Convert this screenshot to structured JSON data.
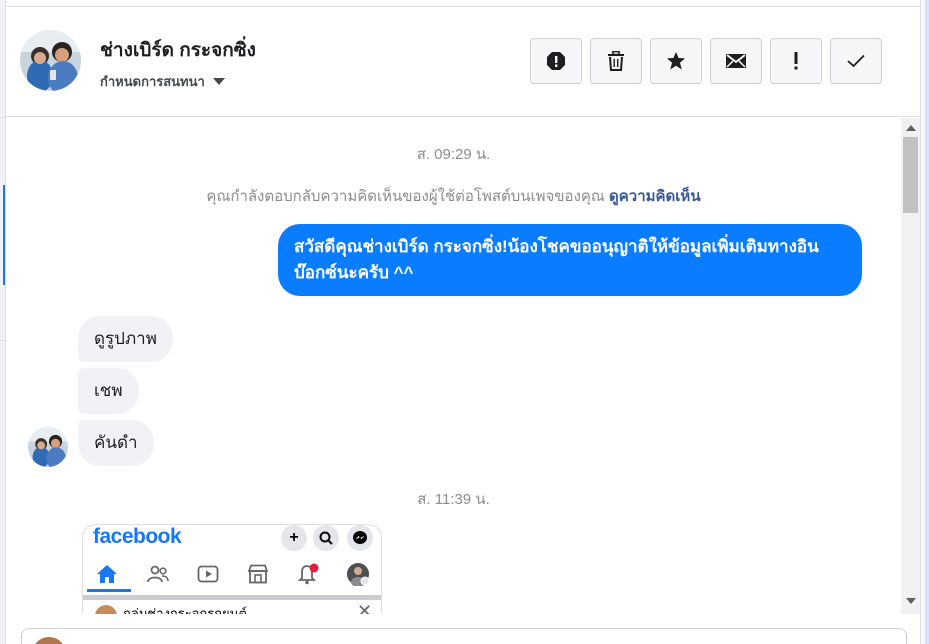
{
  "contact": {
    "name": "ช่างเบิร์ด กระจกซิ่ง",
    "assign_label": "กำหนดการสนทนา"
  },
  "actions": [
    {
      "icon": "report-icon"
    },
    {
      "icon": "trash-icon"
    },
    {
      "icon": "star-icon"
    },
    {
      "icon": "mail-icon"
    },
    {
      "icon": "exclamation-icon"
    },
    {
      "icon": "checkmark-icon"
    }
  ],
  "thread": {
    "timestamp_1": "ส. 09:29 น.",
    "notice_text": "คุณกำลังตอบกลับความคิดเห็นของผู้ใช้ต่อโพสต์บนเพจของคุณ ",
    "notice_link": "ดูความคิดเห็น",
    "outgoing_message": "สวัสดีคุณช่างเบิร์ด กระจกซิ่ง!น้องโชคขออนุญาติให้ข้อมูลเพิ่มเติมทางอินบ๊อกซ์นะครับ ^^",
    "incoming_messages": [
      "ดูรูปภาพ",
      "เชพ",
      "คันดำ"
    ],
    "timestamp_2": "ส. 11:39 น."
  },
  "attachment": {
    "brand_text": "facebook",
    "notification_count": "1",
    "post_preview_text": "กลุ่มช่างกระจกรถยนต์ ...",
    "brand_color": "#1877f2"
  },
  "colors": {
    "outgoing_bubble": "#0a7cff",
    "incoming_bubble": "#f0f2f5",
    "link": "#385898"
  }
}
